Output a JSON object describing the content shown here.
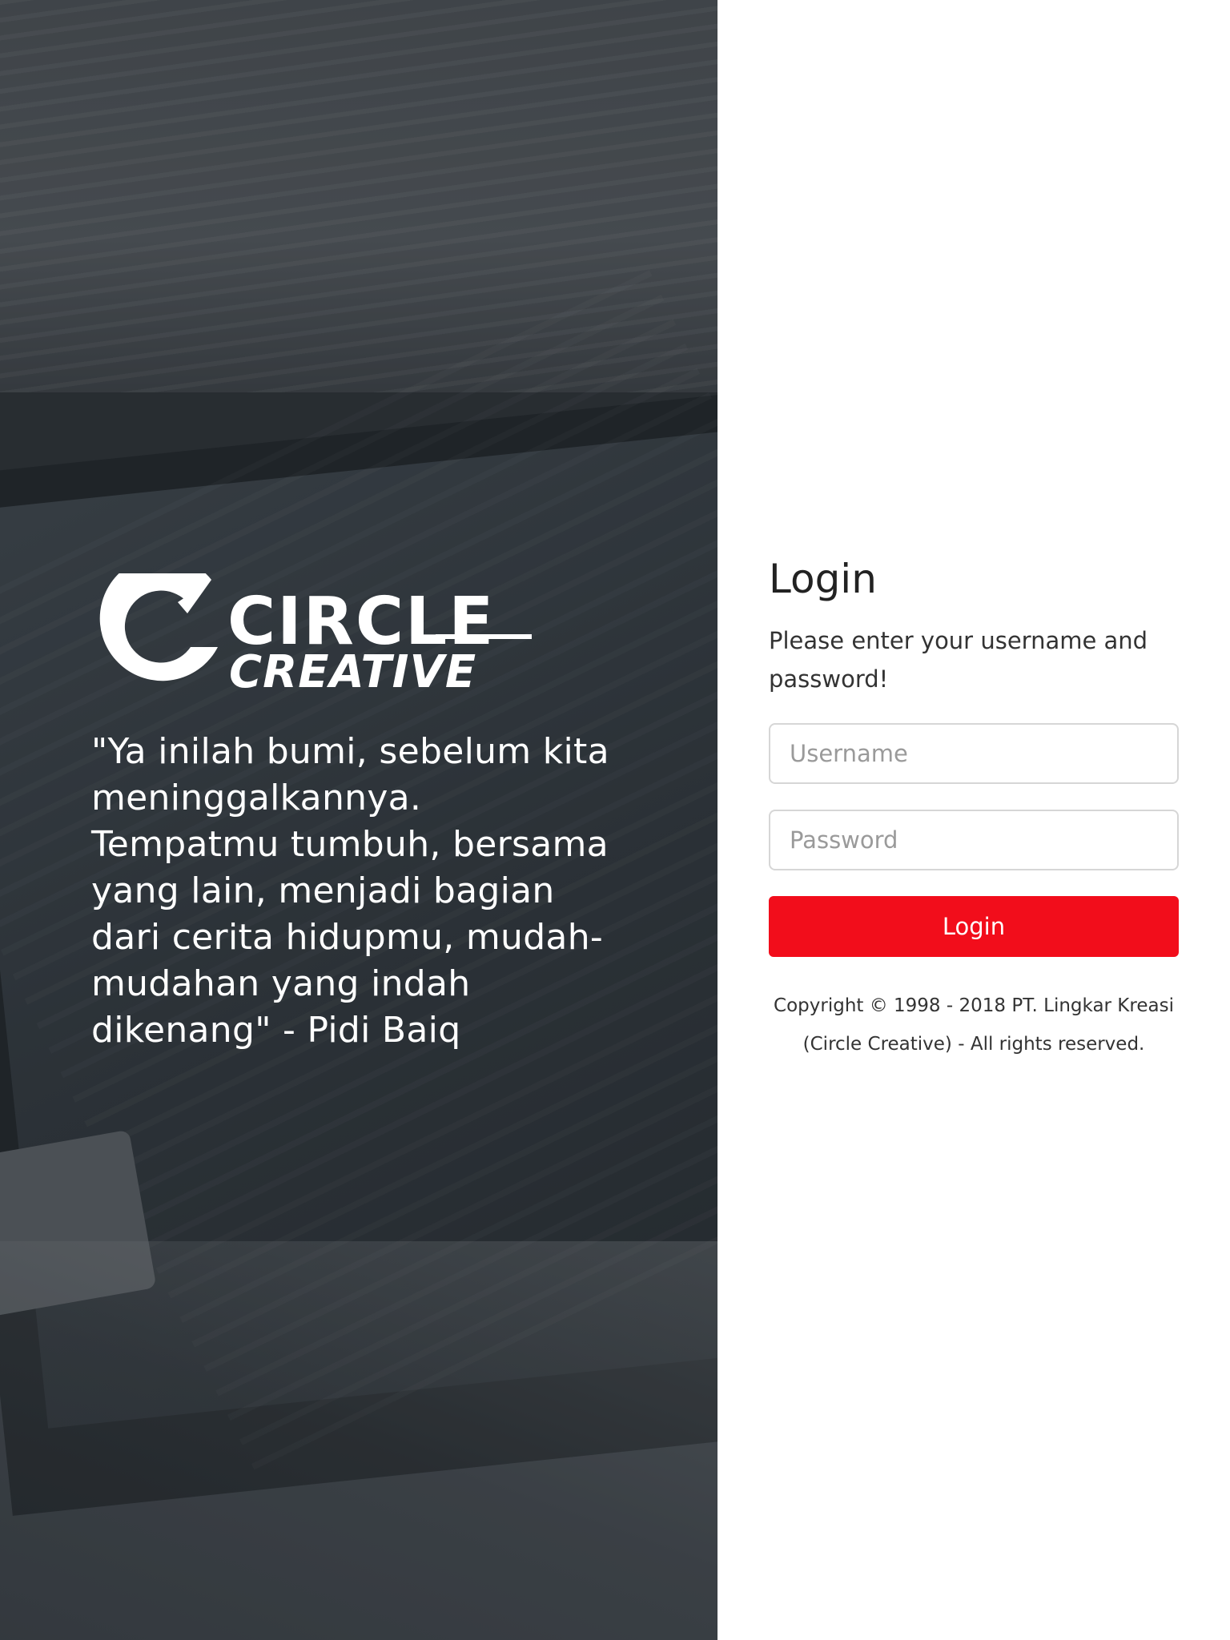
{
  "hero": {
    "logo_text_line1": "CIRCLE",
    "logo_text_line2": "CREATIVE",
    "quote": "\"Ya inilah bumi, sebelum kita meninggalkannya. Tempatmu tumbuh, bersama yang lain, menjadi bagian dari cerita hidupmu, mudah-mudahan yang indah dikenang\" - Pidi Baiq"
  },
  "login": {
    "title": "Login",
    "subtitle": "Please enter your username and password!",
    "username_placeholder": "Username",
    "username_value": "",
    "password_placeholder": "Password",
    "password_value": "",
    "button_label": "Login",
    "copyright": "Copyright © 1998 - 2018 PT. Lingkar Kreasi (Circle Creative) - All rights reserved."
  },
  "colors": {
    "button": "#f20d1b",
    "panel_right": "#ffffff",
    "overlay_left": "#2f353a"
  }
}
